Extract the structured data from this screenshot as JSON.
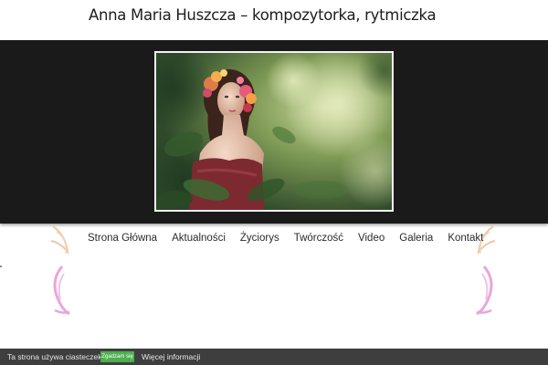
{
  "header": {
    "site_title": "Anna Maria Huszcza – kompozytorka, rytmiczka"
  },
  "hero": {
    "image_alt": "photo-woman-flower-wreath"
  },
  "nav": {
    "items": [
      {
        "label": "Strona Główna"
      },
      {
        "label": "Aktualności"
      },
      {
        "label": "Życiorys"
      },
      {
        "label": "Twórczość"
      },
      {
        "label": "Video"
      },
      {
        "label": "Galeria"
      },
      {
        "label": "Kontakt"
      }
    ]
  },
  "cookie_bar": {
    "message": "Ta strona używa ciasteczek",
    "accept_label": "Zgadzam się",
    "more_label": "Więcej informacji"
  },
  "colors": {
    "hero_band": "#1a1a1a",
    "cookie_bar": "#3e3e3e",
    "accept_button": "#4caf50",
    "decor_pink": "#e9a6da",
    "decor_peach": "#f0c8a6"
  }
}
